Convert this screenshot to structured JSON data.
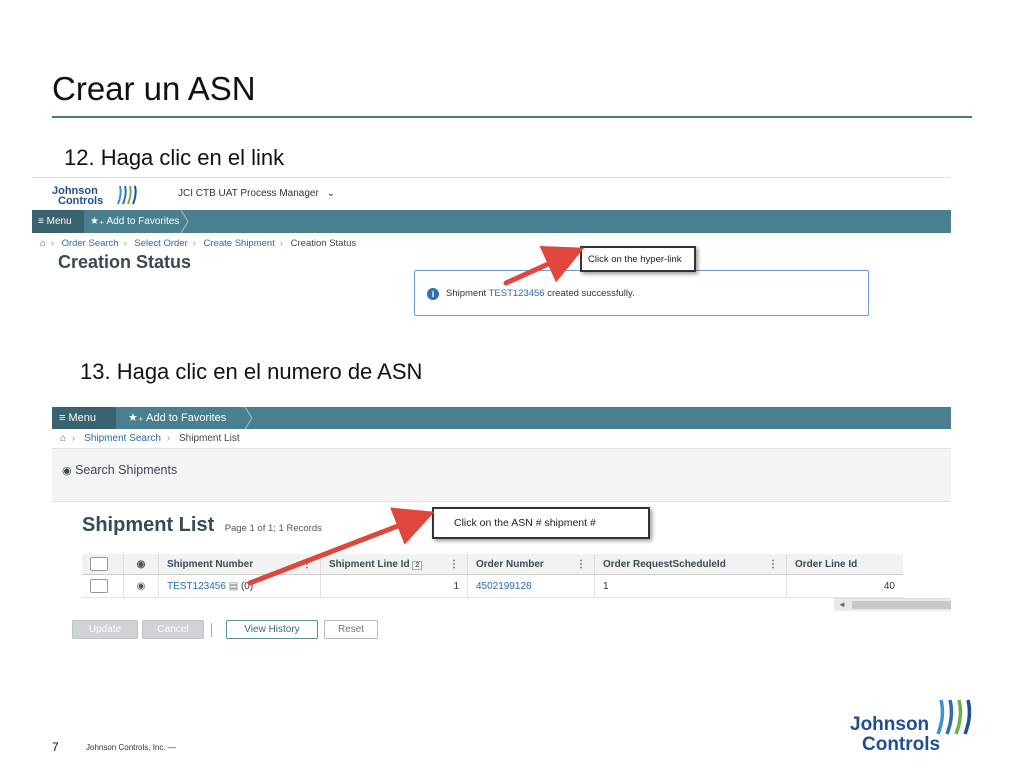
{
  "slide": {
    "title": "Crear un ASN",
    "step12": "12. Haga clic en el link",
    "step13": "13. Haga clic en el numero de ASN",
    "page_number": "7",
    "footer": "Johnson Controls, Inc. —"
  },
  "logo": {
    "line1": "Johnson",
    "line2": "Controls"
  },
  "shot1": {
    "app_title": "JCI CTB UAT Process Manager",
    "dropdown_icon": "chevron-down-icon",
    "menu_label": "Menu",
    "favorites_label": "Add to Favorites",
    "breadcrumbs": [
      "Order Search",
      "Select Order",
      "Create Shipment"
    ],
    "breadcrumb_current": "Creation Status",
    "page_title": "Creation Status",
    "msg_prefix": "Shipment",
    "msg_link": "TEST123456",
    "msg_suffix": "created successfully.",
    "callout": "Click on the hyper-link"
  },
  "shot2": {
    "menu_label": "Menu",
    "favorites_label": "Add to Favorites",
    "breadcrumb_link": "Shipment Search",
    "breadcrumb_current": "Shipment List",
    "search_label": "Search Shipments",
    "list_title": "Shipment List",
    "page_info": "Page 1 of 1; 1 Records",
    "callout": "Click on the ASN # shipment #",
    "columns": {
      "shipment_number": "Shipment Number",
      "shipment_line_id": "Shipment Line Id",
      "shipment_line_badge": "2",
      "order_number": "Order Number",
      "order_request_schedule_id": "Order RequestScheduleId",
      "order_line_id": "Order Line Id"
    },
    "row": {
      "shipment_number": "TEST123456",
      "count": "(0)",
      "shipment_line_id": "1",
      "order_number": "4502199128",
      "order_request_schedule_id": "1",
      "order_line_id": "40"
    },
    "buttons": {
      "update": "Update",
      "cancel": "Cancel",
      "view_history": "View History",
      "reset": "Reset"
    }
  },
  "colors": {
    "accent_bar": "#4a7f8f",
    "link": "#2b6aa8",
    "arrow": "#e0463c",
    "title_rule": "#4a7b8c"
  }
}
